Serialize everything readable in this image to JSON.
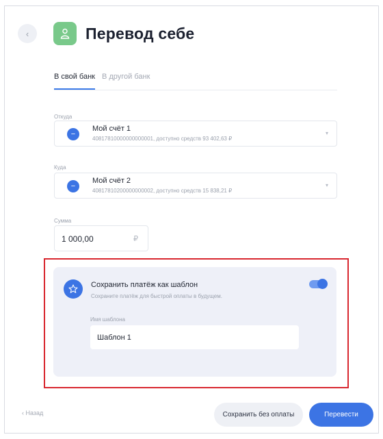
{
  "header": {
    "back_icon": "chevron-left-icon",
    "title_icon": "person-icon",
    "title": "Перевод себе"
  },
  "tabs": [
    {
      "label": "В свой банк",
      "active": true
    },
    {
      "label": "В другой банк",
      "active": false
    }
  ],
  "from": {
    "label": "Откуда",
    "account_name": "Мой счёт 1",
    "account_details": "40817810000000000001, доступно средств 93 402,63 ₽"
  },
  "to": {
    "label": "Куда",
    "account_name": "Мой счёт 2",
    "account_details": "40817810200000000002, доступно средств 15 838,21 ₽"
  },
  "amount": {
    "label": "Сумма",
    "value": "1 000,00",
    "currency": "₽"
  },
  "template": {
    "icon": "star-icon",
    "title": "Сохранить платёж как шаблон",
    "subtitle": "Сохраните платёж для быстрой оплаты в будущем.",
    "enabled": true,
    "name_label": "Имя шаблона",
    "name_value": "Шаблон 1"
  },
  "footer": {
    "back_label": "Назад",
    "save_label": "Сохранить без оплаты",
    "submit_label": "Перевести"
  },
  "colors": {
    "accent": "#3c74e4",
    "highlight": "#d8262e",
    "title_icon_bg": "#79c98a"
  }
}
